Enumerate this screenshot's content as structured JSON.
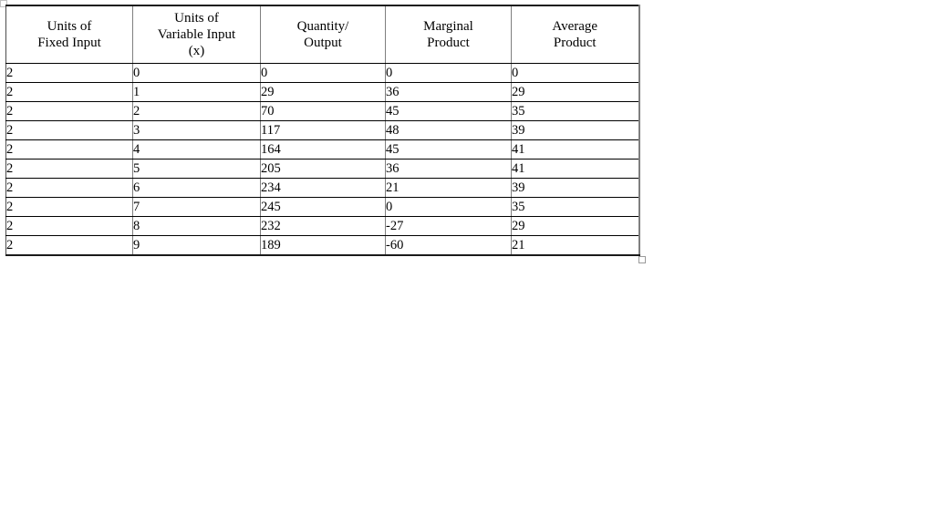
{
  "table": {
    "name": "production-function-table",
    "columns": [
      {
        "id": "fixed-input",
        "lines": [
          "Units of",
          "Fixed Input"
        ]
      },
      {
        "id": "variable-input",
        "lines": [
          "Units of",
          "Variable Input",
          "(x)"
        ]
      },
      {
        "id": "quantity-output",
        "lines": [
          "Quantity/",
          "Output"
        ]
      },
      {
        "id": "marginal-product",
        "lines": [
          "Marginal",
          "Product"
        ]
      },
      {
        "id": "average-product",
        "lines": [
          "Average",
          "Product"
        ]
      }
    ],
    "rows": [
      [
        "2",
        "0",
        "0",
        "0",
        "0"
      ],
      [
        "2",
        "1",
        "29",
        "36",
        "29"
      ],
      [
        "2",
        "2",
        "70",
        "45",
        "35"
      ],
      [
        "2",
        "3",
        "117",
        "48",
        "39"
      ],
      [
        "2",
        "4",
        "164",
        "45",
        "41"
      ],
      [
        "2",
        "5",
        "205",
        "36",
        "41"
      ],
      [
        "2",
        "6",
        "234",
        "21",
        "39"
      ],
      [
        "2",
        "7",
        "245",
        "0",
        "35"
      ],
      [
        "2",
        "8",
        "232",
        "-27",
        "29"
      ],
      [
        "2",
        "9",
        "189",
        "-60",
        "21"
      ]
    ]
  },
  "handles": {
    "move_label": "",
    "resize_label": ""
  },
  "colors": {
    "page_background": "#ffffff",
    "text": "#000000",
    "inner_border": "#000000",
    "outer_border": "#7f7f7f",
    "handle_border": "#9a9a9a"
  }
}
